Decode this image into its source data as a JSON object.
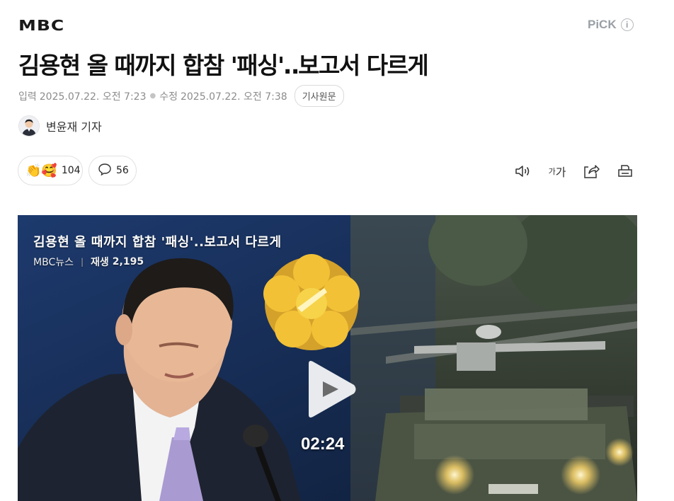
{
  "header": {
    "logo": "MBC",
    "pick_label": "PiCK",
    "info_icon_glyph": "i"
  },
  "article": {
    "headline": "김용현 올 때까지 합참 '패싱'‥보고서 다르게",
    "input_label": "입력",
    "input_date": "2025.07.22. 오전 7:23",
    "modified_label": "수정",
    "modified_date": "2025.07.22. 오전 7:38",
    "original_button": "기사원문",
    "reporter": "변윤재 기자"
  },
  "reactions": {
    "reaction_count": "104",
    "comment_count": "56",
    "emoji_1": "👏",
    "emoji_2": "🥰"
  },
  "tools": {
    "font_small": "가",
    "font_large": "가"
  },
  "video": {
    "title": "김용현 올 때까지 합참 '패싱'..보고서 다르게",
    "channel": "MBC뉴스",
    "views_label": "재생",
    "views": "2,195",
    "duration": "02:24"
  },
  "colors": {
    "accent_gray": "#9aa0a6",
    "text": "#111111",
    "meta": "#8c8c8c"
  }
}
